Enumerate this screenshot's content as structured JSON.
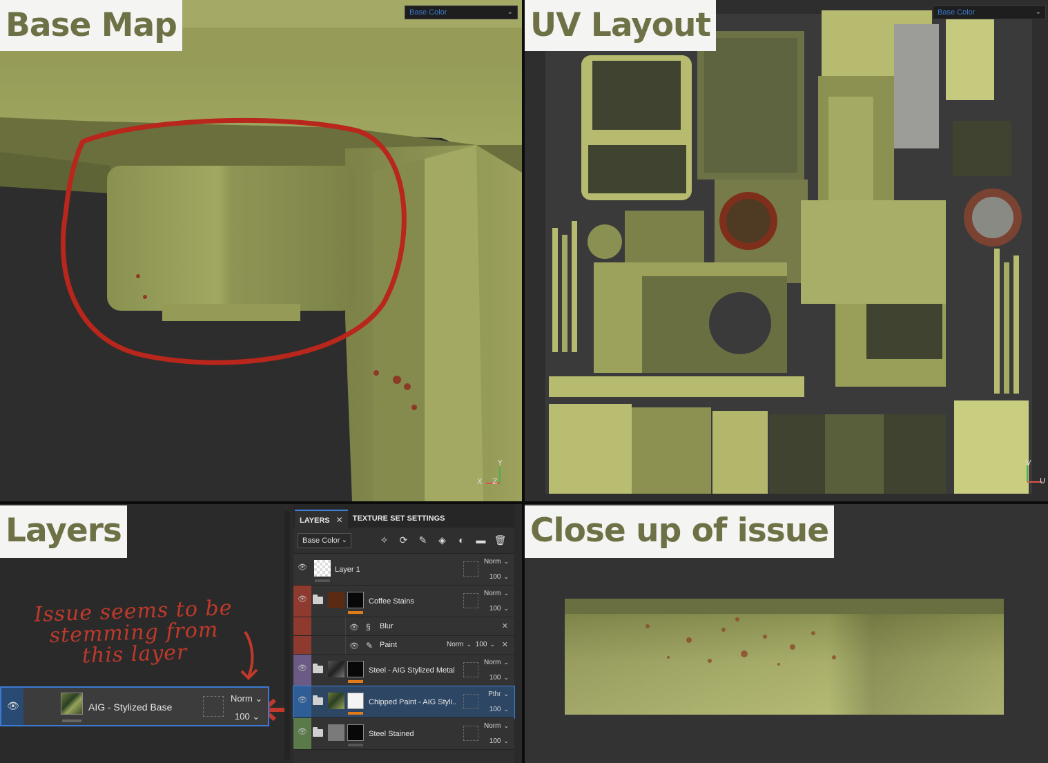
{
  "panels": {
    "base_map": {
      "title": "Base Map",
      "channel": "Base Color",
      "axis_y": "Y",
      "axis_x": "X",
      "axis_z": "Z"
    },
    "uv_layout": {
      "title": "UV Layout",
      "channel": "Base Color",
      "axis_v": "V",
      "axis_u": "U"
    },
    "layers": {
      "title": "Layers"
    },
    "close_up": {
      "title": "Close up of issue"
    }
  },
  "layer_stack": {
    "tabs": [
      {
        "label": "LAYERS",
        "active": true,
        "close": "✕"
      },
      {
        "label": "TEXTURE SET SETTINGS",
        "active": false
      }
    ],
    "channel_select": "Base Color",
    "tools": [
      "add-effect-icon",
      "add-smart-icon",
      "paint-icon",
      "fill-icon",
      "mask-icon",
      "folder-icon",
      "delete-icon"
    ],
    "layers": [
      {
        "name": "Layer 1",
        "blend": "Norm",
        "opacity": "100",
        "tint": "",
        "folder": false
      },
      {
        "name": "Coffee Stains",
        "blend": "Norm",
        "opacity": "100",
        "tint": "#8f3a2e",
        "folder": true,
        "effects": [
          {
            "name": "Blur",
            "icon": "blur-icon",
            "blend": "",
            "opacity": ""
          },
          {
            "name": "Paint",
            "icon": "paint-icon",
            "blend": "Norm",
            "opacity": "100"
          }
        ]
      },
      {
        "name": "Steel - AIG Stylized Metal",
        "blend": "Norm",
        "opacity": "100",
        "tint": "#6b5a85",
        "folder": true
      },
      {
        "name": "Chipped Paint - AIG Styli...",
        "blend": "Pthr",
        "opacity": "100",
        "tint": "#2f5d95",
        "folder": true,
        "selected": true
      },
      {
        "name": "Steel Stained",
        "blend": "Norm",
        "opacity": "100",
        "tint": "#5a7a4a",
        "folder": true
      }
    ]
  },
  "highlighted_layer": {
    "name": "AIG - Stylized Base",
    "blend": "Norm",
    "opacity": "100"
  },
  "annotation": {
    "text": "Issue seems to be stemming from this layer"
  },
  "colors": {
    "accent_blue": "#3b7fd6",
    "annotation_red": "#c0392b",
    "title_olive": "#6e7145",
    "olive_paint": "#b6bb6f"
  }
}
